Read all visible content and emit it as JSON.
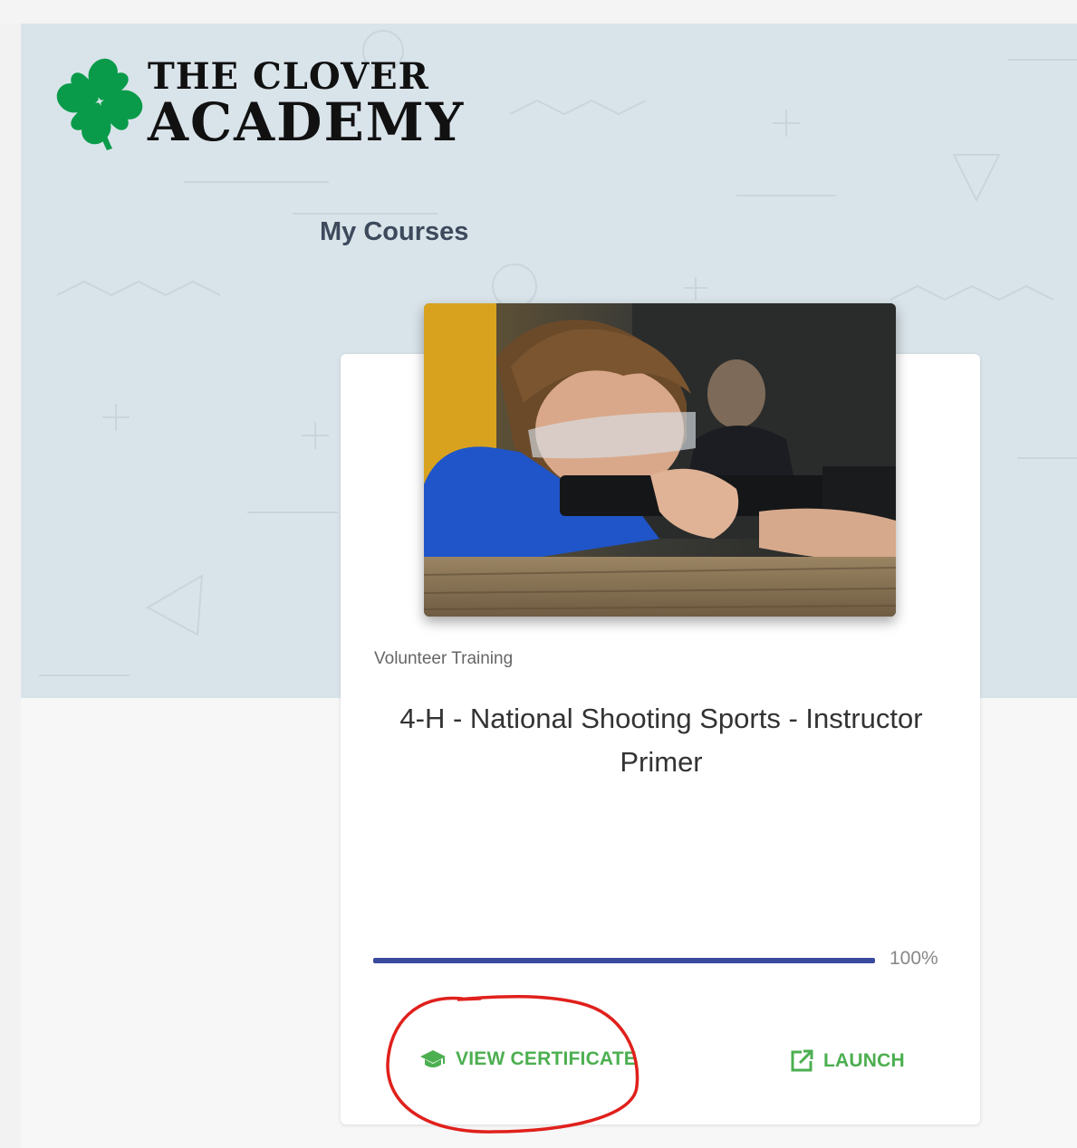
{
  "logo": {
    "line1": "THE CLOVER",
    "line2": "ACADEMY",
    "brand_color": "#0a9b4a"
  },
  "page": {
    "title": "My Courses"
  },
  "course_card": {
    "category": "Volunteer Training",
    "title": "4-H - National Shooting Sports - Instructor Primer",
    "progress_value": 100,
    "progress_label": "100%",
    "progress_color": "#3a4a9e",
    "actions": {
      "view_certificate": {
        "label": "VIEW CERTIFICATE",
        "icon": "graduation-cap-icon"
      },
      "launch": {
        "label": "LAUNCH",
        "icon": "open-in-new-icon"
      }
    },
    "action_color": "#4caf50"
  },
  "annotation": {
    "color": "#e0201c"
  }
}
